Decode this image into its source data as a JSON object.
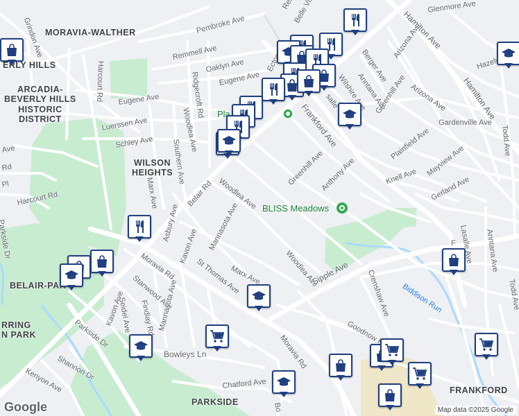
{
  "map": {
    "attribution": "Map data ©2025 Google",
    "logo": "Google",
    "colors": {
      "water": "#aadaff",
      "park": "#c8ecd0",
      "urban": "#f0e6c8",
      "marker_border": "#1f3f80",
      "poi_text": "#188038"
    },
    "areas": [
      {
        "name": "area-moravia-walther",
        "text": "MORAVIA-WALTHER"
      },
      {
        "name": "area-beverly-hills",
        "text": "ERLY HILLS"
      },
      {
        "name": "area-arcadia",
        "text": "ARCADIA-\nBEVERLY HILLS\nHISTORIC\nDISTRICT"
      },
      {
        "name": "area-wilson-heights",
        "text": "WILSON\nHEIGHTS"
      },
      {
        "name": "area-belair-parkside",
        "text": "BELAIR-PAR"
      },
      {
        "name": "area-herring-run-park",
        "text": "RRING\nN PARK"
      },
      {
        "name": "area-parkside",
        "text": "PARKSIDE"
      },
      {
        "name": "area-frankford",
        "text": "FRANKFORD"
      }
    ],
    "poi": [
      {
        "name": "poi-plantation-press",
        "text": "Pla"
      },
      {
        "name": "poi-bliss-meadows",
        "text": "BLISS Meadows"
      }
    ],
    "streets": [
      {
        "text": "Pembroke Ave"
      },
      {
        "text": "Remmell Ave"
      },
      {
        "text": "Oaklyn Ave"
      },
      {
        "text": "Eugene Ave"
      },
      {
        "text": "Ridgecroft Rd"
      },
      {
        "text": "Woodlea Ave"
      },
      {
        "text": "Southern Ave"
      },
      {
        "text": "Eugene Ave"
      },
      {
        "text": "Luerssen Ave"
      },
      {
        "text": "Schley Ave"
      },
      {
        "text": "Harcourt Rd"
      },
      {
        "text": "Harcourt Rd"
      },
      {
        "text": "Grindon Ave"
      },
      {
        "text": "Belair Rd"
      },
      {
        "text": "Woodlea Ave"
      },
      {
        "text": "Asbury Ave"
      },
      {
        "text": "Kavon Ave"
      },
      {
        "text": "Mannasota Ave"
      },
      {
        "text": "Marx Ave"
      },
      {
        "text": "Moravia Rd"
      },
      {
        "text": "St Thomas Ave"
      },
      {
        "text": "Marx Ave"
      },
      {
        "text": "Stanwood Ave"
      },
      {
        "text": "Seidel Ave"
      },
      {
        "text": "Kavon Ave"
      },
      {
        "text": "Findlay Rd"
      },
      {
        "text": "Mannasota Ave"
      },
      {
        "text": "Parkside Dr"
      },
      {
        "text": "Shannon Dr"
      },
      {
        "text": "Kenyon Ave"
      },
      {
        "text": "Bowleys Ln"
      },
      {
        "text": "Moravia Rd"
      },
      {
        "text": "Chatford Ave"
      },
      {
        "text": "Frankford Ave"
      },
      {
        "text": "Greenhill Ave"
      },
      {
        "text": "Anthony Ave"
      },
      {
        "text": "Woodlea Ave"
      },
      {
        "text": "Sipple Ave"
      },
      {
        "text": "Crenshaw Ave"
      },
      {
        "text": "Biddison Run"
      },
      {
        "text": "Goodnow R"
      },
      {
        "text": "Belle Vista Ave"
      },
      {
        "text": "Ecton"
      },
      {
        "text": "Berger Ave"
      },
      {
        "text": "Anntana Ave"
      },
      {
        "text": "Wilshire Ave"
      },
      {
        "text": "Greenhill Ave"
      },
      {
        "text": "Arizona Ave"
      },
      {
        "text": "Arizona Ave"
      },
      {
        "text": "Hamilton Ave"
      },
      {
        "text": "Hamilton Ave"
      },
      {
        "text": "Glenmore Ave"
      },
      {
        "text": "Gardenville Ave"
      },
      {
        "text": "Plainfield Ave"
      },
      {
        "text": "Mayview Ave"
      },
      {
        "text": "Knell Ave"
      },
      {
        "text": "Gerland Ave"
      },
      {
        "text": "Lasalle Ave"
      },
      {
        "text": "Anntana Ave"
      },
      {
        "text": "Todd Ave"
      },
      {
        "text": "Todd Ave"
      },
      {
        "text": "Hazelwood Ave"
      },
      {
        "text": "Parkside Dr"
      },
      {
        "text": "Bo"
      },
      {
        "text": "Remn"
      },
      {
        "text": "Ave"
      },
      {
        "text": "Rd"
      },
      {
        "text": "Pl"
      },
      {
        "text": "F"
      },
      {
        "text": "salle"
      }
    ],
    "markers": [
      {
        "icon": "restaurant-icon"
      },
      {
        "icon": "restaurant-icon"
      },
      {
        "icon": "shopping-bag-icon"
      },
      {
        "icon": "restaurant-icon"
      },
      {
        "icon": "school-icon"
      },
      {
        "icon": "shopping-bag-icon"
      },
      {
        "icon": "restaurant-icon"
      },
      {
        "icon": "restaurant-icon"
      },
      {
        "icon": "shopping-bag-icon"
      },
      {
        "icon": "shopping-bag-icon"
      },
      {
        "icon": "restaurant-icon"
      },
      {
        "icon": "restaurant-icon"
      },
      {
        "icon": "restaurant-icon"
      },
      {
        "icon": "restaurant-icon"
      },
      {
        "icon": "restaurant-icon"
      },
      {
        "icon": "school-icon"
      },
      {
        "icon": "school-icon"
      },
      {
        "icon": "restaurant-icon"
      },
      {
        "icon": "shopping-bag-icon"
      },
      {
        "icon": "shopping-bag-icon"
      },
      {
        "icon": "school-icon"
      },
      {
        "icon": "school-icon"
      },
      {
        "icon": "shopping-cart-icon"
      },
      {
        "icon": "school-icon"
      },
      {
        "icon": "school-icon"
      },
      {
        "icon": "shopping-bag-icon"
      },
      {
        "icon": "shopping-bag-icon"
      },
      {
        "icon": "shopping-bag-icon"
      },
      {
        "icon": "shopping-cart-icon"
      },
      {
        "icon": "shopping-cart-icon"
      },
      {
        "icon": "shopping-cart-icon"
      },
      {
        "icon": "shopping-bag-icon"
      },
      {
        "icon": "school-icon"
      },
      {
        "icon": "shopping-bag-icon"
      }
    ]
  }
}
